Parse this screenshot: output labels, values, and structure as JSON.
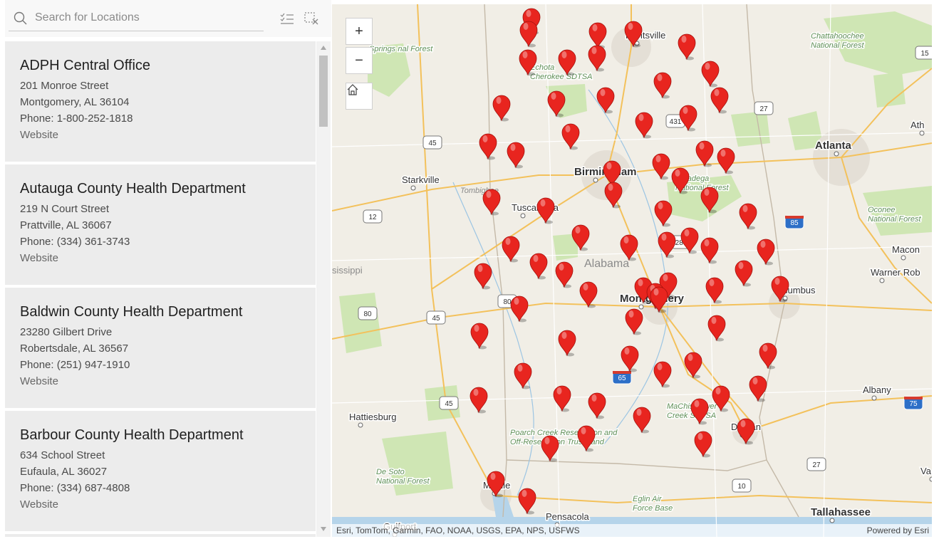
{
  "search": {
    "placeholder": "Search for Locations"
  },
  "locations": [
    {
      "name": "ADPH Central Office",
      "street": "201 Monroe Street",
      "city": "Montgomery, AL 36104",
      "phone": "Phone: 1-800-252-1818",
      "website": "Website"
    },
    {
      "name": "Autauga County Health Department",
      "street": "219 N Court Street",
      "city": "Prattville, AL 36067",
      "phone": "Phone: (334) 361-3743",
      "website": "Website"
    },
    {
      "name": "Baldwin County Health Department",
      "street": "23280 Gilbert Drive",
      "city": "Robertsdale, AL 36567",
      "phone": "Phone: (251) 947-1910",
      "website": "Website"
    },
    {
      "name": "Barbour County Health Department",
      "street": "634 School Street",
      "city": "Eufaula, AL 36027",
      "phone": "Phone: (334) 687-4808",
      "website": "Website"
    }
  ],
  "map": {
    "zoom_in": "+",
    "zoom_out": "−",
    "attribution": "Esri, TomTom, Garmin, FAO, NOAA, USGS, EPA, NPS, USFWS",
    "powered_by": "Powered by Esri",
    "marker_color": "#e8251f",
    "cities": [
      "Huntsville",
      "Birmingham",
      "Starkville",
      "Tuscaloosa",
      "Montgomery",
      "Columbus",
      "Atlanta",
      "Macon",
      "Warner Rob",
      "Albany",
      "Dothan",
      "Hattiesburg",
      "Mobile",
      "Pensacola",
      "Tallahassee",
      "Gulfport",
      "Ath",
      "Va"
    ],
    "region_labels": [
      "Alabama",
      "sissippi",
      "Tombigbee"
    ],
    "park_labels": [
      "Chattahoochee National Forest",
      "Springs nal Forest",
      "Echota Cherokee SDTSA",
      "Talladega National Forest",
      "Oconee National Forest",
      "MaChis Lower Creek SDTSA",
      "Poarch Creek Reservation and Off-Reservation Trust Land",
      "De Soto National Forest",
      "Eglin Air Force Base"
    ],
    "highway_shields": [
      "45",
      "12",
      "80",
      "45",
      "80",
      "45",
      "27",
      "431",
      "280",
      "10",
      "27",
      "15",
      "65",
      "85",
      "75"
    ]
  }
}
